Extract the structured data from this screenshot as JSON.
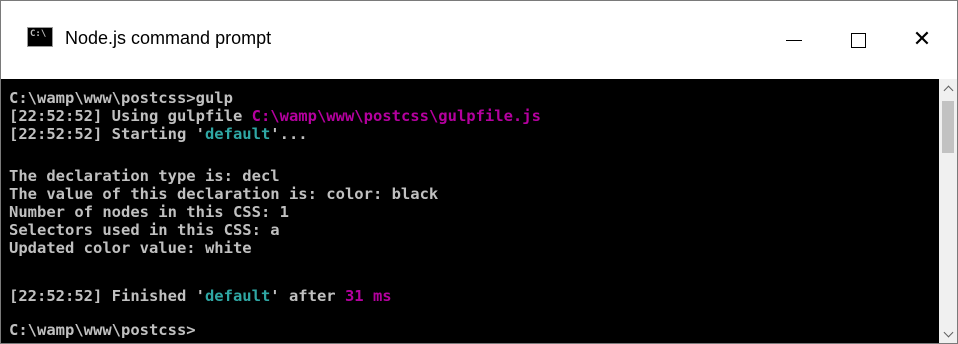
{
  "window": {
    "title": "Node.js command prompt",
    "icon": "console-icon",
    "icon_text": "C:\\"
  },
  "controls": {
    "minimize": "—",
    "maximize": "☐",
    "close": "✕"
  },
  "console": {
    "lines": {
      "l1": "C:\\wamp\\www\\postcss>gulp",
      "l2_prefix": "[22:52:52] Using gulpfile ",
      "l2_path": "C:\\wamp\\www\\postcss\\gulpfile.js",
      "l3_prefix": "[22:52:52] Starting '",
      "l3_task": "default",
      "l3_suffix": "'...",
      "l4": "The declaration type is: decl",
      "l5": "The value of this declaration is: color: black",
      "l6": "Number of nodes in this CSS: 1",
      "l7": "Selectors used in this CSS: a",
      "l8": "Updated color value: white",
      "l9_prefix": "[22:52:52] Finished '",
      "l9_task": "default",
      "l9_mid": "' after ",
      "l9_time": "31 ms",
      "l10": "C:\\wamp\\www\\postcss>"
    }
  },
  "colors": {
    "console_bg": "#000000",
    "console_fg": "#c0c0c0",
    "task_color": "#2fa7a4",
    "path_color": "#b4009e"
  }
}
